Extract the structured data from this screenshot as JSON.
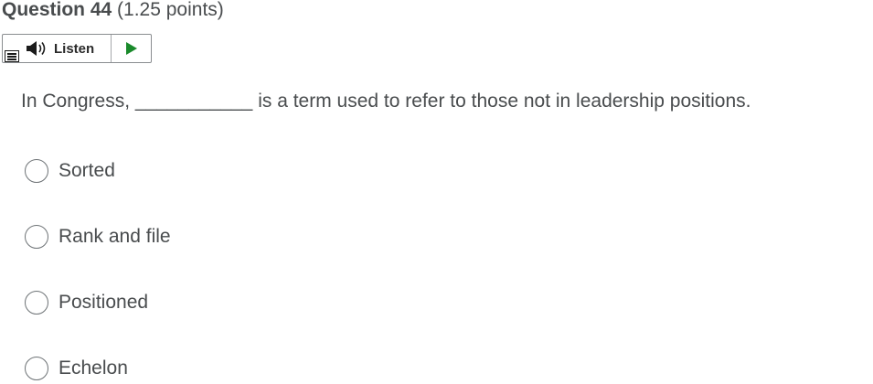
{
  "question": {
    "title": "Question 44",
    "points": "(1.25 points)",
    "text": "In Congress, ___________ is a term used to refer to those not in leadership positions."
  },
  "listen": {
    "label": "Listen",
    "speaker_icon": "speaker-icon",
    "play_icon": "play-icon",
    "menu_icon": "menu-icon",
    "play_color": "#1a8a2b"
  },
  "options": [
    {
      "label": "Sorted"
    },
    {
      "label": "Rank and file"
    },
    {
      "label": "Positioned"
    },
    {
      "label": "Echelon"
    }
  ]
}
